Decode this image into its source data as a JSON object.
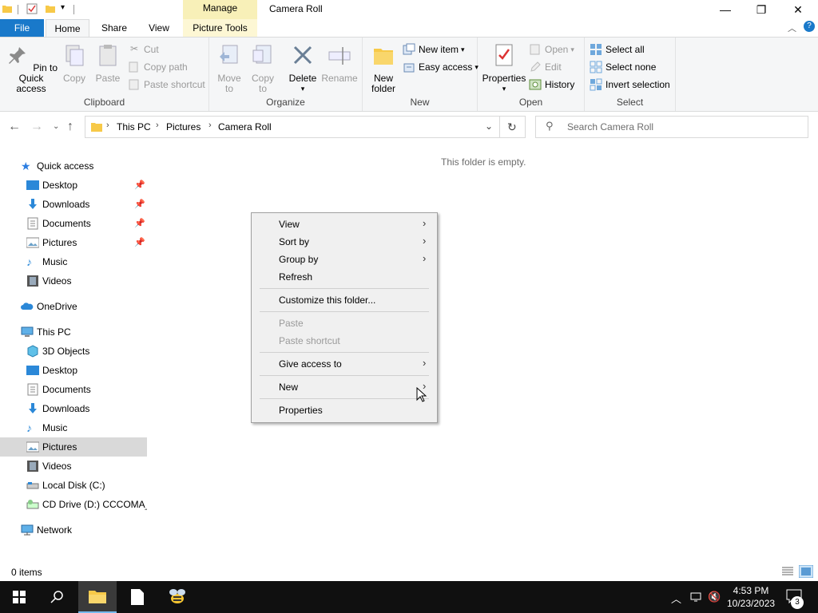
{
  "window": {
    "title": "Camera Roll",
    "context_tab": "Manage",
    "minimize": "—",
    "restore": "❐",
    "close": "✕"
  },
  "tabs": {
    "file": "File",
    "home": "Home",
    "share": "Share",
    "view": "View",
    "picture_tools": "Picture Tools"
  },
  "ribbon": {
    "clipboard": {
      "label": "Clipboard",
      "pin": "Pin to Quick access",
      "copy": "Copy",
      "paste": "Paste",
      "cut": "Cut",
      "copy_path": "Copy path",
      "paste_shortcut": "Paste shortcut"
    },
    "organize": {
      "label": "Organize",
      "move_to": "Move to",
      "copy_to": "Copy to",
      "delete": "Delete",
      "rename": "Rename"
    },
    "new": {
      "label": "New",
      "new_folder": "New folder",
      "new_item": "New item",
      "easy_access": "Easy access"
    },
    "open": {
      "label": "Open",
      "properties": "Properties",
      "open": "Open",
      "edit": "Edit",
      "history": "History"
    },
    "select": {
      "label": "Select",
      "select_all": "Select all",
      "select_none": "Select none",
      "invert": "Invert selection"
    }
  },
  "address": {
    "crumbs": [
      "This PC",
      "Pictures",
      "Camera Roll"
    ],
    "search_placeholder": "Search Camera Roll"
  },
  "nav": {
    "quick_access": "Quick access",
    "qa_items": [
      "Desktop",
      "Downloads",
      "Documents",
      "Pictures",
      "Music",
      "Videos"
    ],
    "onedrive": "OneDrive",
    "this_pc": "This PC",
    "pc_items": [
      "3D Objects",
      "Desktop",
      "Documents",
      "Downloads",
      "Music",
      "Pictures",
      "Videos",
      "Local Disk (C:)",
      "CD Drive (D:) CCCOMA_X"
    ],
    "network": "Network"
  },
  "content": {
    "empty_message": "This folder is empty."
  },
  "context_menu": {
    "view": "View",
    "sort_by": "Sort by",
    "group_by": "Group by",
    "refresh": "Refresh",
    "customize": "Customize this folder...",
    "paste": "Paste",
    "paste_shortcut": "Paste shortcut",
    "give_access": "Give access to",
    "new": "New",
    "properties": "Properties"
  },
  "status": {
    "items": "0 items"
  },
  "taskbar": {
    "time": "4:53 PM",
    "date": "10/23/2023",
    "notifications": "3"
  }
}
